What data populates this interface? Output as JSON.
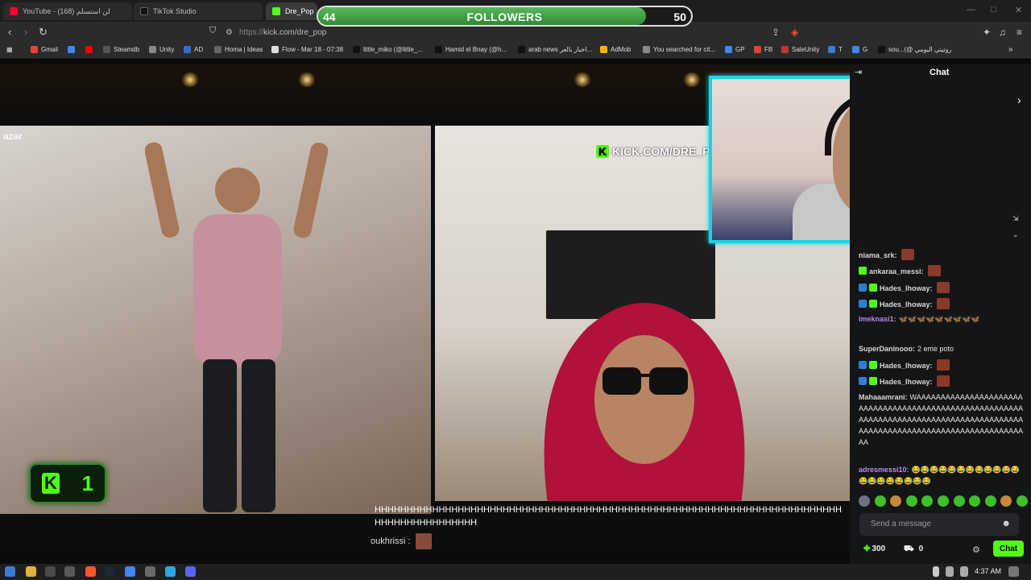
{
  "tabs": [
    {
      "label": "YouTube - لن استسلم (168)",
      "color": "#ff0033"
    },
    {
      "label": "TikTok Studio",
      "color": "#111111"
    },
    {
      "label": "Dre_Pop",
      "color": "#53fc18"
    }
  ],
  "address": {
    "protocol": "https://",
    "host": "kick.com/dre_pop"
  },
  "bookmarks": [
    {
      "label": "Gmail",
      "color": "#ea4335"
    },
    {
      "label": "",
      "color": "#4285f4"
    },
    {
      "label": "",
      "color": "#ff0000"
    },
    {
      "label": "Steamdb",
      "color": "#555555"
    },
    {
      "label": "Unity",
      "color": "#888888"
    },
    {
      "label": "AD",
      "color": "#2b6fd6"
    },
    {
      "label": "Homa | Ideas",
      "color": "#666666"
    },
    {
      "label": "Flow - Mar 18 - 07:38",
      "color": "#dddddd"
    },
    {
      "label": "little_miko (@little_...",
      "color": "#111111"
    },
    {
      "label": "Hamid el Bnay (@h...",
      "color": "#111111"
    },
    {
      "label": "arab news اخبار بالعر...",
      "color": "#111111"
    },
    {
      "label": "AdMob",
      "color": "#f4b400"
    },
    {
      "label": "You searched for cit...",
      "color": "#888888"
    },
    {
      "label": "GP",
      "color": "#4285f4"
    },
    {
      "label": "FB",
      "color": "#e0403a"
    },
    {
      "label": "SaleUnity",
      "color": "#c0392b"
    },
    {
      "label": "T",
      "color": "#3a7bd5"
    },
    {
      "label": "G",
      "color": "#4285f4"
    },
    {
      "label": "sou...(@ روتيني اليومي",
      "color": "#111111"
    }
  ],
  "followers_goal": {
    "current": "44",
    "label": "FOLLOWERS",
    "goal": "50",
    "progress": 0.88
  },
  "stream": {
    "azar_logo": "azar",
    "watermark": "KICK.COM/DRE_POP",
    "kick_counter": "1",
    "overlay_message": "HHHHHHHHHHHHHHHHHHHHHHHHHHHHHHHHHHHHHHHHHHHHHHHHHHHHHHHHHHHHHHHHHHHHHHHHHHHHHHHHHHHHHHHHH",
    "overlay_user": "oukhrissi :"
  },
  "chat": {
    "title": "Chat",
    "messages": [
      {
        "user": "niama_srk:",
        "color": "#d7d7d7",
        "text": "",
        "badges": 0,
        "emotes": 1
      },
      {
        "user": "ankaraa_messi:",
        "color": "#d7d7d7",
        "text": "",
        "badges": 1,
        "emotes": 1
      },
      {
        "user": "Hades_lhoway:",
        "color": "#d7d7d7",
        "text": "",
        "badges": 2,
        "emotes": 1
      },
      {
        "user": "Hades_lhoway:",
        "color": "#d7d7d7",
        "text": "",
        "badges": 2,
        "emotes": 1
      },
      {
        "user": "lmeknasi1:",
        "color": "#b48cf2",
        "text": "🦋🦋🦋🦋🦋🦋🦋🦋🦋",
        "badges": 0,
        "emotes": 0
      },
      {
        "user": "SuperDaninooo:",
        "color": "#d7d7d7",
        "text": "2 eme poto",
        "badges": 0,
        "emotes": 0
      },
      {
        "user": "Hades_lhoway:",
        "color": "#d7d7d7",
        "text": "",
        "badges": 2,
        "emotes": 1
      },
      {
        "user": "Hades_lhoway:",
        "color": "#d7d7d7",
        "text": "",
        "badges": 2,
        "emotes": 1
      },
      {
        "user": "Mahaaamrani:",
        "color": "#d7d7d7",
        "text": "WAAAAAAAAAAAAAAAAAAAAAAAAAAAAAAAAAAAAAAAAAAAAAAAAAAAAAAAAAAAAAAAAAAAAAAAAAAAAAAAAAAAAAAAAAAAAAAAAAAAAAAAAAAAAAAAAAAAAAAAAAAAAAA",
        "badges": 0,
        "emotes": 0
      },
      {
        "user": "adresmessi10:",
        "color": "#b48cf2",
        "text": "😂😂😂😂😂😂😂😂😂😂😂😂😂😂😂😂😂😂😂😂",
        "badges": 0,
        "emotes": 0
      }
    ],
    "input_placeholder": "Send a message",
    "points": "300",
    "store_count": "0",
    "send_label": "Chat"
  },
  "taskbar": {
    "time": "4:37 AM"
  }
}
